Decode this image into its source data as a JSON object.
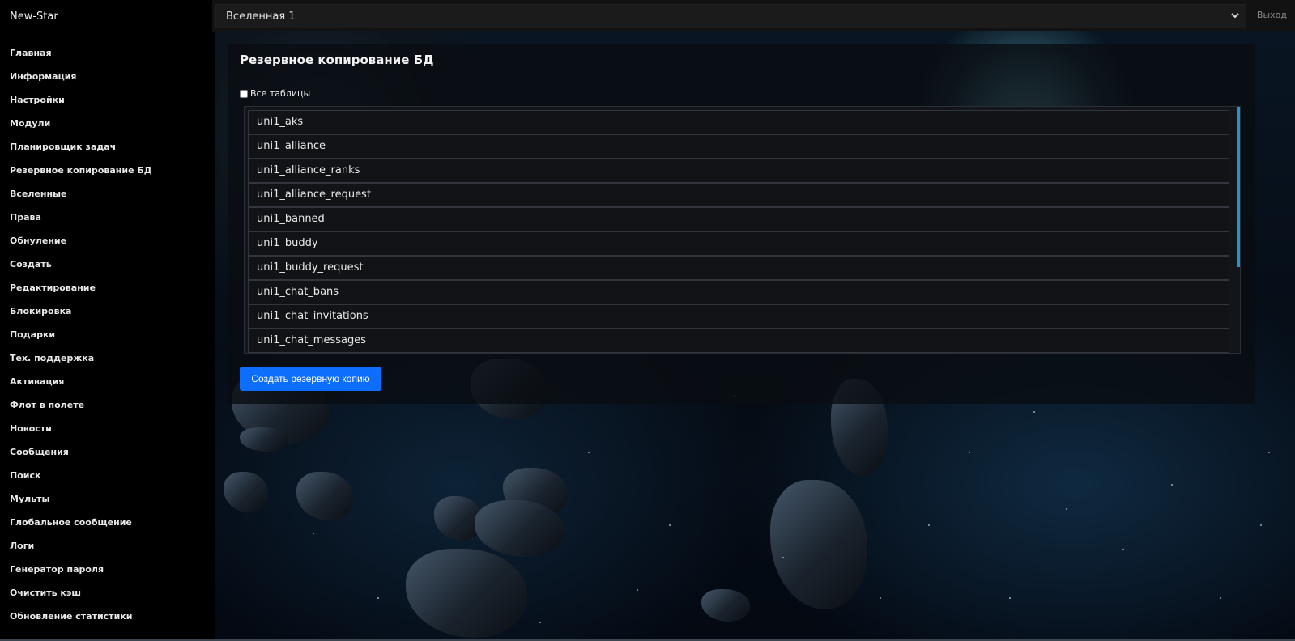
{
  "app": {
    "brand": "New-Star",
    "logout_label": "Выход"
  },
  "universe_select": {
    "selected": "Вселенная 1"
  },
  "sidebar": {
    "items": [
      {
        "label": "Главная"
      },
      {
        "label": "Информация"
      },
      {
        "label": "Настройки"
      },
      {
        "label": "Модули"
      },
      {
        "label": "Планировщик задач"
      },
      {
        "label": "Резервное копирование БД"
      },
      {
        "label": "Вселенные"
      },
      {
        "label": "Права"
      },
      {
        "label": "Обнуление"
      },
      {
        "label": "Создать"
      },
      {
        "label": "Редактирование"
      },
      {
        "label": "Блокировка"
      },
      {
        "label": "Подарки"
      },
      {
        "label": "Тех. поддержка"
      },
      {
        "label": "Активация"
      },
      {
        "label": "Флот в полете"
      },
      {
        "label": "Новости"
      },
      {
        "label": "Сообщения"
      },
      {
        "label": "Поиск"
      },
      {
        "label": "Мульты"
      },
      {
        "label": "Глобальное сообщение"
      },
      {
        "label": "Логи"
      },
      {
        "label": "Генератор пароля"
      },
      {
        "label": "Очистить кэш"
      },
      {
        "label": "Обновление статистики"
      }
    ]
  },
  "main": {
    "title": "Резервное копирование БД",
    "all_tables_label": "Все таблицы",
    "tables": [
      "uni1_aks",
      "uni1_alliance",
      "uni1_alliance_ranks",
      "uni1_alliance_request",
      "uni1_banned",
      "uni1_buddy",
      "uni1_buddy_request",
      "uni1_chat_bans",
      "uni1_chat_invitations",
      "uni1_chat_messages"
    ],
    "backup_button": "Создать резервную копию"
  },
  "colors": {
    "accent": "#0d6efd",
    "scrollbar": "#2c8fd0"
  }
}
